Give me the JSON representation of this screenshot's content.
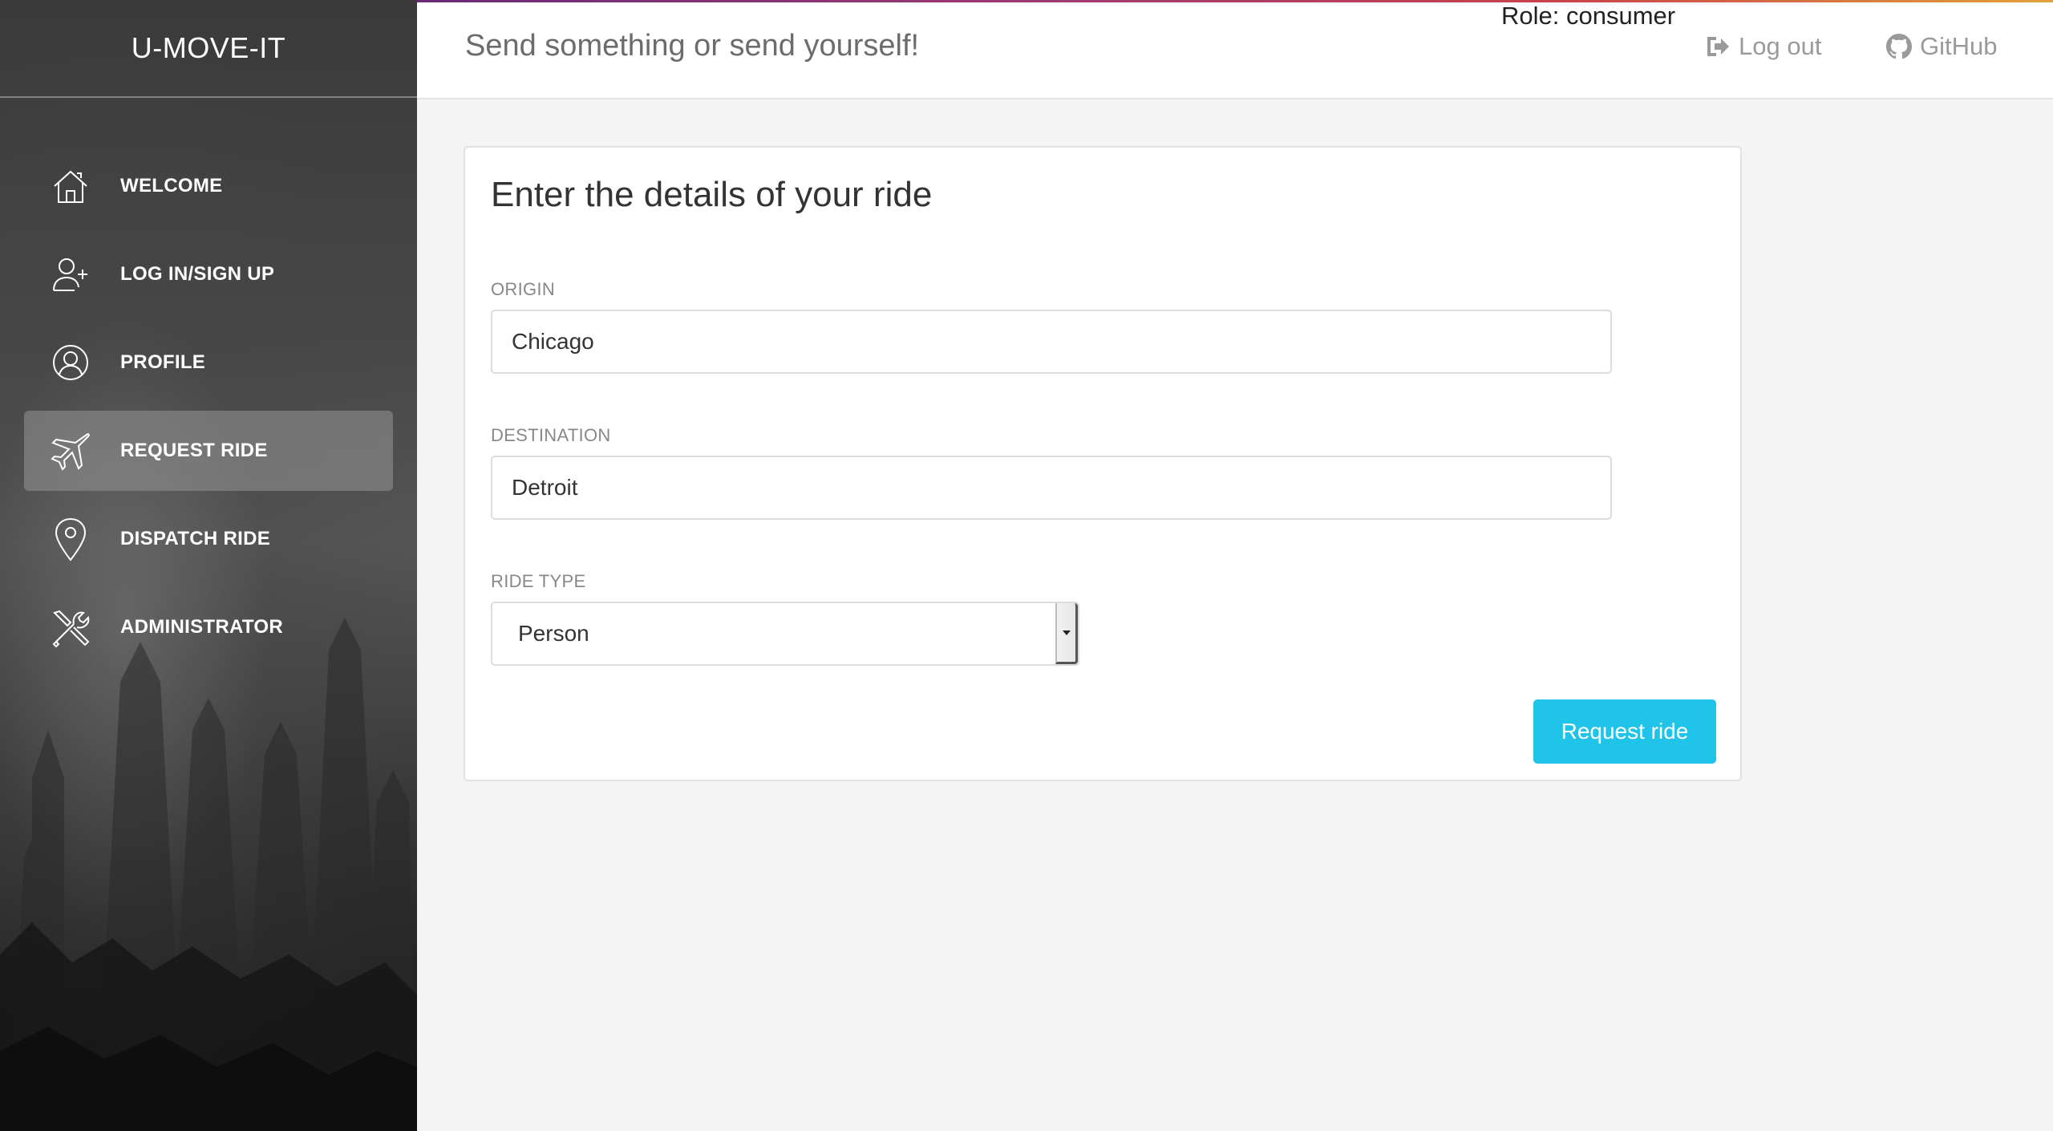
{
  "sidebar": {
    "brand": "U-MOVE-IT",
    "items": [
      {
        "label": "WELCOME",
        "icon": "home-icon"
      },
      {
        "label": "LOG IN/SIGN UP",
        "icon": "user-add-icon"
      },
      {
        "label": "PROFILE",
        "icon": "profile-icon"
      },
      {
        "label": "REQUEST RIDE",
        "icon": "airplane-icon",
        "active": true
      },
      {
        "label": "DISPATCH RIDE",
        "icon": "map-pin-icon"
      },
      {
        "label": "ADMINISTRATOR",
        "icon": "tools-icon"
      }
    ]
  },
  "header": {
    "title": "Send something or send yourself!",
    "role": "Role: consumer",
    "logout_label": "Log out",
    "logout_icon": "sign-out-icon",
    "github_label": "GitHub",
    "github_icon": "github-icon"
  },
  "form": {
    "title": "Enter the details of your ride",
    "origin_label": "ORIGIN",
    "origin_value": "Chicago",
    "destination_label": "DESTINATION",
    "destination_value": "Detroit",
    "ride_type_label": "RIDE TYPE",
    "ride_type_value": "Person",
    "submit_label": "Request ride"
  },
  "colors": {
    "accent": "#1fc4e8",
    "sidebar_dark": "#1b1b1b",
    "page_background": "#f4f4f4"
  }
}
